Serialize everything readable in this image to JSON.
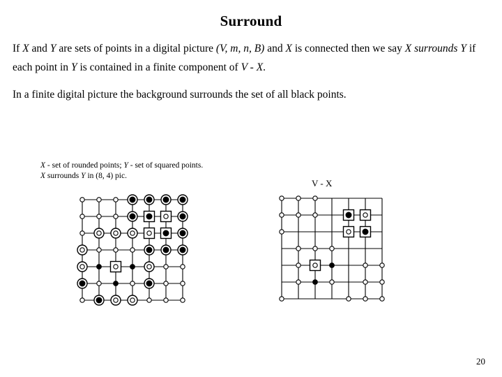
{
  "slide": {
    "title": "Surround",
    "page_number": "20",
    "paragraph_1": {
      "runs": [
        {
          "t": "If ",
          "style": "normal"
        },
        {
          "t": "X",
          "style": "italic"
        },
        {
          "t": " and ",
          "style": "normal"
        },
        {
          "t": "Y",
          "style": "italic"
        },
        {
          "t": " are sets of points in a digital picture ",
          "style": "normal"
        },
        {
          "t": "(V, m, n, B)",
          "style": "italic"
        },
        {
          "t": " and ",
          "style": "normal"
        },
        {
          "t": "X",
          "style": "italic"
        },
        {
          "t": " is connected then we say ",
          "style": "normal"
        },
        {
          "t": "X surrounds",
          "style": "italic"
        },
        {
          "t": " ",
          "style": "normal"
        },
        {
          "t": "Y",
          "style": "italic"
        },
        {
          "t": " if each point in ",
          "style": "normal"
        },
        {
          "t": "Y",
          "style": "italic"
        },
        {
          "t": " is contained in a finite component of ",
          "style": "normal"
        },
        {
          "t": "V - X",
          "style": "italic"
        },
        {
          "t": ".",
          "style": "normal"
        }
      ],
      "plain": "If X and Y are sets of points in a digital picture (V, m, n, B) and X is connected then we say X surrounds Y if each point in Y is contained in a finite component of V - X."
    },
    "paragraph_2": {
      "plain": "In a finite digital picture the background surrounds the set of all black points."
    },
    "left_caption": {
      "line_1_runs": [
        {
          "t": "X",
          "style": "italic"
        },
        {
          "t": " - set of rounded points; ",
          "style": "normal"
        },
        {
          "t": "Y",
          "style": "italic"
        },
        {
          "t": " - set of squared points.",
          "style": "normal"
        }
      ],
      "line_2_runs": [
        {
          "t": "X",
          "style": "italic"
        },
        {
          "t": " surrounds ",
          "style": "normal"
        },
        {
          "t": "Y",
          "style": "italic"
        },
        {
          "t": " in (8, 4) pic.",
          "style": "normal"
        }
      ],
      "line_1_plain": "X - set of rounded points; Y - set of squared points.",
      "line_2_plain": "X surrounds Y in (8, 4) pic."
    },
    "right_label": "V - X"
  },
  "colors": {
    "ink": "#000000",
    "background": "#ffffff",
    "grid_line": "#000000",
    "node_fill_open": "#ffffff",
    "node_fill_black": "#000000"
  },
  "chart_data": {
    "type": "scatter",
    "title": "Surround — digital picture lattices",
    "figures": [
      {
        "name": "left-lattice",
        "caption": "X - set of rounded points; Y - set of squared points. X surrounds Y in (8, 4) pic.",
        "grid": {
          "cols": 7,
          "rows": 7,
          "spacing": 24,
          "origin": [
            10,
            6
          ]
        },
        "marker_legend": {
          "plain": "small open circle (ordinary point)",
          "ring-open": "open circle inside ring (X point, white)",
          "ring-filled": "black dot inside ring (X point, black)",
          "square-open": "open circle inside square (Y point, white)",
          "square-filled": "black dot inside square (Y point, black)",
          "dot": "black dot (black point, not in X or Y)"
        },
        "nodes": [
          [
            "plain",
            "plain",
            "plain",
            "ring-filled",
            "ring-filled",
            "ring-filled",
            "ring-filled"
          ],
          [
            "plain",
            "plain",
            "plain",
            "ring-filled",
            "square-filled",
            "square-open",
            "ring-filled"
          ],
          [
            "plain",
            "ring-open",
            "ring-open",
            "ring-open",
            "square-open",
            "square-filled",
            "ring-filled"
          ],
          [
            "ring-open",
            "plain",
            "plain",
            "plain",
            "ring-filled",
            "ring-filled",
            "ring-filled"
          ],
          [
            "ring-open",
            "dot",
            "square-open",
            "dot",
            "ring-open",
            "plain",
            "plain"
          ],
          [
            "ring-filled",
            "plain",
            "dot",
            "plain",
            "ring-filled",
            "plain",
            "plain"
          ],
          [
            "plain",
            "ring-filled",
            "ring-open",
            "ring-open",
            "plain",
            "plain",
            "plain"
          ]
        ]
      },
      {
        "name": "right-lattice",
        "caption": "V - X",
        "grid": {
          "cols": 7,
          "rows": 7,
          "spacing": 24,
          "origin": [
            8,
            6
          ]
        },
        "marker_legend": {
          "plain": "small open circle (point of V - X)",
          "square-open": "open circle inside square (Y point, white)",
          "square-filled": "black dot inside square (Y point, black)",
          "dot": "black dot (black point)",
          "none": "no marker"
        },
        "nodes": [
          [
            "plain",
            "plain",
            "plain",
            "none",
            "none",
            "none",
            "none"
          ],
          [
            "plain",
            "plain",
            "plain",
            "none",
            "square-filled",
            "square-open",
            "none"
          ],
          [
            "plain",
            "none",
            "none",
            "none",
            "square-open",
            "square-filled",
            "none"
          ],
          [
            "none",
            "plain",
            "plain",
            "plain",
            "none",
            "none",
            "none"
          ],
          [
            "none",
            "plain",
            "square-open",
            "dot",
            "none",
            "plain",
            "plain"
          ],
          [
            "none",
            "plain",
            "dot",
            "plain",
            "none",
            "plain",
            "plain"
          ],
          [
            "plain",
            "none",
            "none",
            "none",
            "plain",
            "plain",
            "plain"
          ]
        ]
      }
    ]
  }
}
